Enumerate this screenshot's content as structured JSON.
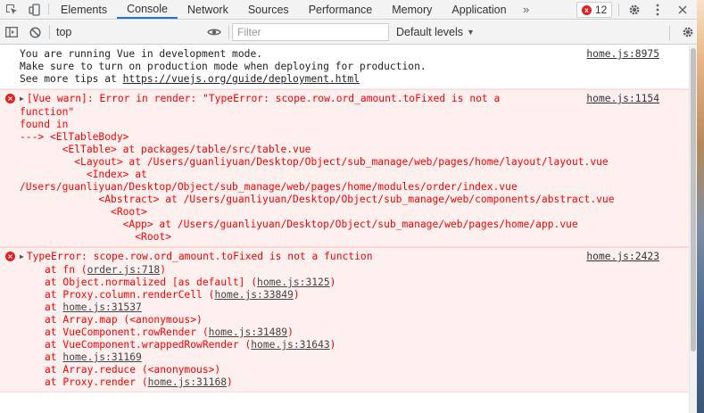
{
  "tabbar": {
    "tabs": [
      {
        "label": "Elements",
        "active": false
      },
      {
        "label": "Console",
        "active": true
      },
      {
        "label": "Network",
        "active": false
      },
      {
        "label": "Sources",
        "active": false
      },
      {
        "label": "Performance",
        "active": false
      },
      {
        "label": "Memory",
        "active": false
      },
      {
        "label": "Application",
        "active": false
      }
    ],
    "more_label": "»",
    "error_count": "12",
    "error_icon": "x"
  },
  "toolbar": {
    "context": "top",
    "filter_placeholder": "Filter",
    "levels_label": "Default levels",
    "levels_caret": "▼"
  },
  "messages": {
    "m1": {
      "type": "log",
      "lines": [
        "You are running Vue in development mode.",
        "Make sure to turn on production mode when deploying for production."
      ],
      "tip_prefix": "See more tips at ",
      "tip_link": "https://vuejs.org/guide/deployment.html",
      "source": "home.js:8975"
    },
    "m2": {
      "type": "error",
      "lines": [
        "[Vue warn]: Error in render: \"TypeError: scope.row.ord_amount.toFixed is not a",
        "function\"",
        "",
        "found in",
        "",
        "---> <ElTableBody>",
        "       <ElTable> at packages/table/src/table.vue",
        "         <Layout> at /Users/guanliyuan/Desktop/Object/sub_manage/web/pages/home/layout/layout.vue",
        "           <Index> at",
        "/Users/guanliyuan/Desktop/Object/sub_manage/web/pages/home/modules/order/index.vue",
        "             <Abstract> at /Users/guanliyuan/Desktop/Object/sub_manage/web/components/abstract.vue",
        "               <Root>",
        "                 <App> at /Users/guanliyuan/Desktop/Object/sub_manage/web/pages/home/app.vue",
        "                   <Root>"
      ],
      "source": "home.js:1154"
    },
    "m3": {
      "type": "error",
      "head": "TypeError: scope.row.ord_amount.toFixed is not a function",
      "source": "home.js:2423",
      "stack": [
        {
          "pre": "at fn (",
          "link": "order.js:718",
          "post": ")"
        },
        {
          "pre": "at Object.normalized [as default] (",
          "link": "home.js:3125",
          "post": ")"
        },
        {
          "pre": "at Proxy.column.renderCell (",
          "link": "home.js:33849",
          "post": ")"
        },
        {
          "pre": "at ",
          "link": "home.js:31537",
          "post": ""
        },
        {
          "pre": "at Array.map (<anonymous>)",
          "link": "",
          "post": ""
        },
        {
          "pre": "at VueComponent.rowRender (",
          "link": "home.js:31489",
          "post": ")"
        },
        {
          "pre": "at VueComponent.wrappedRowRender (",
          "link": "home.js:31643",
          "post": ")"
        },
        {
          "pre": "at ",
          "link": "home.js:31169",
          "post": ""
        },
        {
          "pre": "at Array.reduce (<anonymous>)",
          "link": "",
          "post": ""
        },
        {
          "pre": "at Proxy.render (",
          "link": "home.js:31168",
          "post": ")"
        }
      ]
    }
  },
  "colors": {
    "error_text": "#ff0000",
    "error_bg": "#fff0f0",
    "active_tab": "#1a73e8"
  }
}
